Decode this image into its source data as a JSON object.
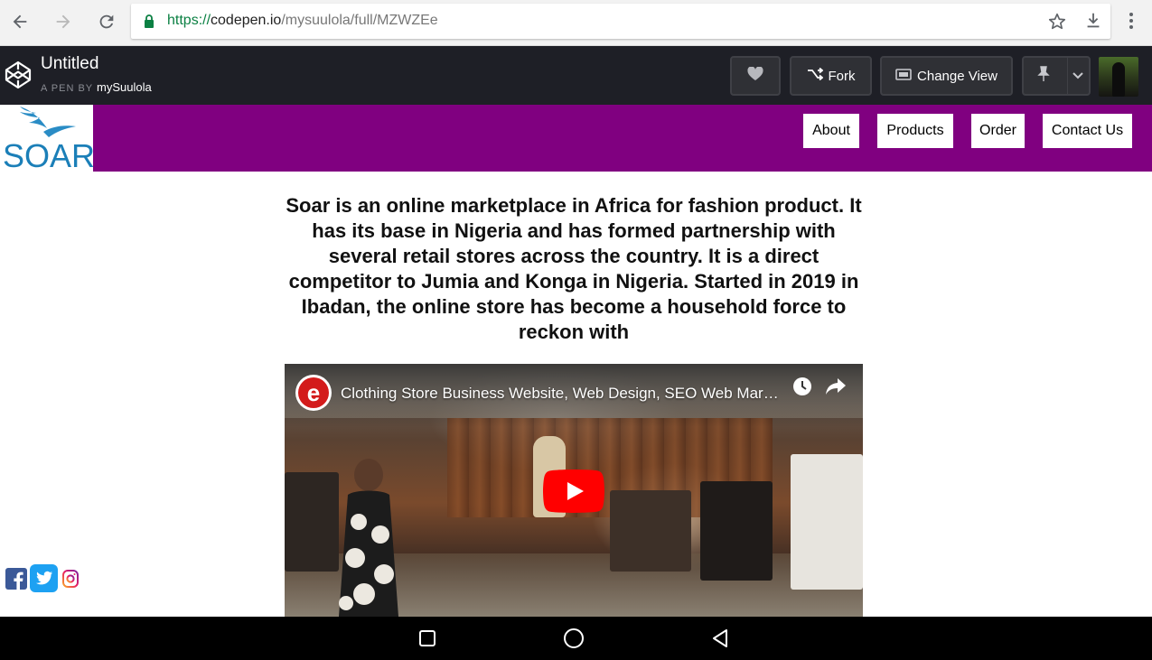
{
  "browser": {
    "url_scheme": "https://",
    "url_host": "codepen.io",
    "url_path": "/mysuulola/full/MZWZEe",
    "icons": [
      "back-arrow-icon",
      "forward-arrow-icon",
      "reload-icon",
      "lock-icon",
      "star-icon",
      "download-icon",
      "more-vert-icon"
    ]
  },
  "codepen": {
    "title": "Untitled",
    "by_label": "A PEN BY",
    "author": "mySuulola",
    "fork_label": "Fork",
    "change_view_label": "Change View",
    "icons": [
      "codepen-logo-icon",
      "heart-icon",
      "fork-icon",
      "change-view-icon",
      "pin-icon",
      "chevron-down-icon"
    ]
  },
  "site": {
    "logo_text": "SOAR",
    "nav": [
      "About",
      "Products",
      "Order",
      "Contact Us"
    ],
    "accent_color": "#800080",
    "intro": "Soar is an online marketplace in Africa for fashion product. It has its base in Nigeria and has formed partnership with several retail stores across the country. It is a direct competitor to Jumia and Konga in Nigeria. Started in 2019 in Ibadan, the online store has become a household force to reckon with"
  },
  "video": {
    "title": "Clothing Store Business Website, Web Design, SEO Web Mar…",
    "badge_letter": "e",
    "icons": [
      "channel-badge-icon",
      "watch-later-icon",
      "share-icon",
      "play-button-icon"
    ]
  },
  "social": [
    "facebook-icon",
    "twitter-icon",
    "instagram-icon"
  ],
  "android": [
    "recents-icon",
    "home-icon",
    "back-icon"
  ]
}
